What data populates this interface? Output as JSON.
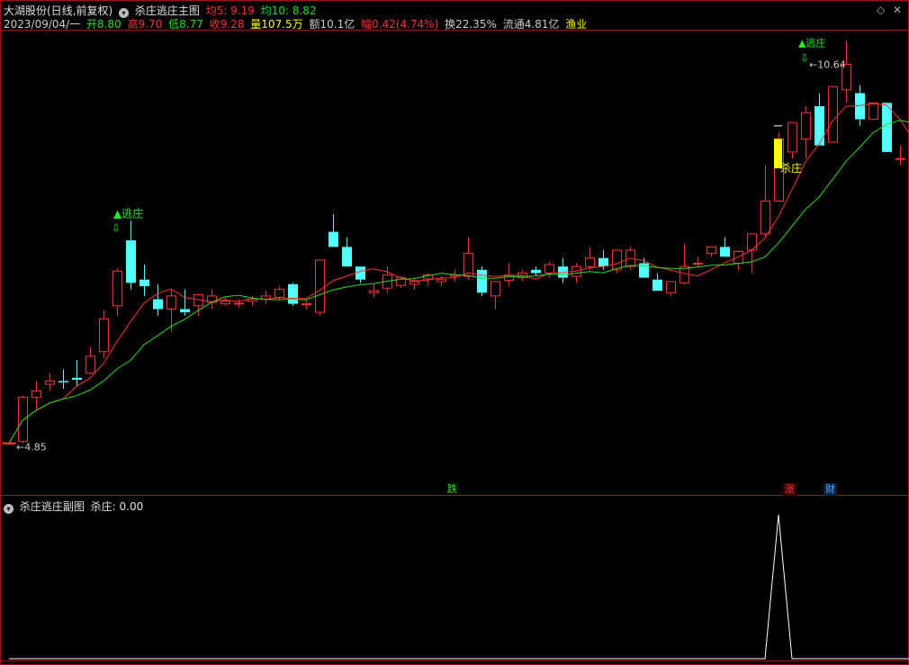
{
  "header": {
    "stock_title": "大湖股份(日线,前复权)",
    "indicator_name": "杀庄逃庄主图",
    "ma5_label": "均5: 9.19",
    "ma10_label": "均10: 8.82",
    "date": "2023/09/04/一",
    "open": "开8.80",
    "high": "高9.70",
    "low": "低8.77",
    "close": "收9.28",
    "volume": "量107.5万",
    "amount": "额10.1亿",
    "change": "幅0.42(4.74%)",
    "turnover": "换22.35%",
    "float_cap": "流通4.81亿",
    "industry": "渔业"
  },
  "window_controls": {
    "diamond": "◇",
    "close": "✕"
  },
  "sub_panel": {
    "title": "杀庄逃庄副图",
    "value_label": "杀庄: 0.00"
  },
  "colors": {
    "up": "#ff3232",
    "down": "#54ffff",
    "ma5": "#ff3232",
    "ma10": "#22dd22",
    "signal": "#ffff00",
    "escape": "#22ee22",
    "grid": "#aa1010"
  },
  "chart_data": {
    "type": "candlestick",
    "y_price_range": [
      4.5,
      11.1
    ],
    "candles": [
      [
        4.85,
        4.85,
        4.85,
        4.85
      ],
      [
        4.88,
        5.58,
        4.85,
        5.55
      ],
      [
        5.55,
        5.8,
        5.35,
        5.65
      ],
      [
        5.75,
        5.92,
        5.65,
        5.8
      ],
      [
        5.8,
        5.98,
        5.68,
        5.78
      ],
      [
        5.85,
        6.12,
        5.72,
        5.82
      ],
      [
        5.92,
        6.32,
        5.9,
        6.18
      ],
      [
        6.25,
        6.88,
        6.15,
        6.75
      ],
      [
        6.95,
        7.52,
        6.8,
        7.48
      ],
      [
        7.95,
        8.25,
        7.2,
        7.3
      ],
      [
        7.35,
        7.58,
        7.1,
        7.25
      ],
      [
        7.05,
        7.28,
        6.8,
        6.9
      ],
      [
        6.9,
        7.2,
        6.55,
        7.1
      ],
      [
        6.9,
        7.2,
        6.8,
        6.85
      ],
      [
        6.95,
        7.1,
        6.8,
        7.12
      ],
      [
        7.0,
        7.2,
        6.9,
        7.1
      ],
      [
        6.98,
        7.08,
        6.95,
        7.02
      ],
      [
        6.98,
        7.05,
        6.92,
        6.99
      ],
      [
        7.02,
        7.1,
        6.95,
        7.05
      ],
      [
        7.05,
        7.18,
        6.98,
        7.1
      ],
      [
        7.08,
        7.25,
        7.05,
        7.2
      ],
      [
        7.28,
        7.3,
        6.95,
        6.98
      ],
      [
        6.98,
        7.05,
        6.9,
        6.98
      ],
      [
        6.85,
        7.65,
        6.8,
        7.65
      ],
      [
        8.08,
        8.35,
        7.85,
        7.85
      ],
      [
        7.85,
        8.0,
        7.55,
        7.55
      ],
      [
        7.55,
        7.5,
        7.3,
        7.35
      ],
      [
        7.15,
        7.28,
        7.08,
        7.18
      ],
      [
        7.22,
        7.55,
        7.15,
        7.42
      ],
      [
        7.26,
        7.4,
        7.22,
        7.38
      ],
      [
        7.28,
        7.38,
        7.2,
        7.32
      ],
      [
        7.36,
        7.45,
        7.26,
        7.42
      ],
      [
        7.32,
        7.4,
        7.25,
        7.35
      ],
      [
        7.4,
        7.5,
        7.32,
        7.42
      ],
      [
        7.4,
        8.0,
        7.35,
        7.75
      ],
      [
        7.5,
        7.55,
        7.1,
        7.15
      ],
      [
        7.1,
        7.28,
        6.9,
        7.32
      ],
      [
        7.34,
        7.6,
        7.25,
        7.42
      ],
      [
        7.38,
        7.5,
        7.33,
        7.45
      ],
      [
        7.5,
        7.55,
        7.4,
        7.45
      ],
      [
        7.45,
        7.62,
        7.38,
        7.58
      ],
      [
        7.55,
        7.68,
        7.3,
        7.38
      ],
      [
        7.4,
        7.6,
        7.3,
        7.55
      ],
      [
        7.55,
        7.85,
        7.5,
        7.68
      ],
      [
        7.68,
        7.8,
        7.5,
        7.55
      ],
      [
        7.5,
        7.8,
        7.45,
        7.8
      ],
      [
        7.55,
        7.85,
        7.5,
        7.8
      ],
      [
        7.6,
        7.68,
        7.4,
        7.38
      ],
      [
        7.35,
        7.45,
        7.25,
        7.18
      ],
      [
        7.15,
        7.3,
        7.1,
        7.32
      ],
      [
        7.3,
        7.9,
        7.28,
        7.55
      ],
      [
        7.6,
        7.7,
        7.55,
        7.6
      ],
      [
        7.75,
        7.85,
        7.7,
        7.85
      ],
      [
        7.85,
        8.0,
        7.8,
        7.7
      ],
      [
        7.6,
        7.8,
        7.5,
        7.78
      ],
      [
        7.8,
        7.9,
        7.45,
        8.05
      ],
      [
        8.05,
        9.1,
        8.0,
        8.55
      ],
      [
        8.55,
        9.6,
        8.7,
        9.5
      ],
      [
        9.3,
        9.7,
        9.2,
        9.75
      ],
      [
        9.5,
        10.0,
        9.2,
        9.9
      ],
      [
        10.0,
        10.2,
        9.4,
        9.4
      ],
      [
        9.45,
        10.25,
        9.8,
        10.3
      ],
      [
        10.25,
        11.0,
        10.05,
        10.64
      ],
      [
        10.2,
        10.32,
        9.7,
        9.8
      ],
      [
        9.8,
        10.05,
        9.95,
        10.05
      ],
      [
        10.05,
        10.0,
        9.3,
        9.3
      ],
      [
        9.2,
        9.4,
        9.1,
        9.2
      ],
      [
        8.9,
        9.2,
        8.8,
        9.1
      ]
    ],
    "ma5_label": "均5",
    "ma10_label": "均10",
    "signals": [
      {
        "type": "escape",
        "label": "逃庄"
      },
      {
        "type": "kill",
        "label": "杀庄"
      },
      {
        "type": "escape",
        "label": "逃庄"
      }
    ],
    "price_annotations": [
      {
        "label": "4.85",
        "value": 4.85
      },
      {
        "label": "10.64",
        "value": 10.64
      }
    ],
    "bottom_markers": [
      {
        "label": "跌",
        "color": "#22ee22"
      },
      {
        "label": "涨",
        "color": "#ff3232"
      },
      {
        "label": "财",
        "color": "#5aaaff"
      }
    ],
    "sub_indicator": {
      "name": "杀庄",
      "values_nonzero": [
        {
          "candle_index": 57,
          "value": 1
        }
      ]
    }
  }
}
